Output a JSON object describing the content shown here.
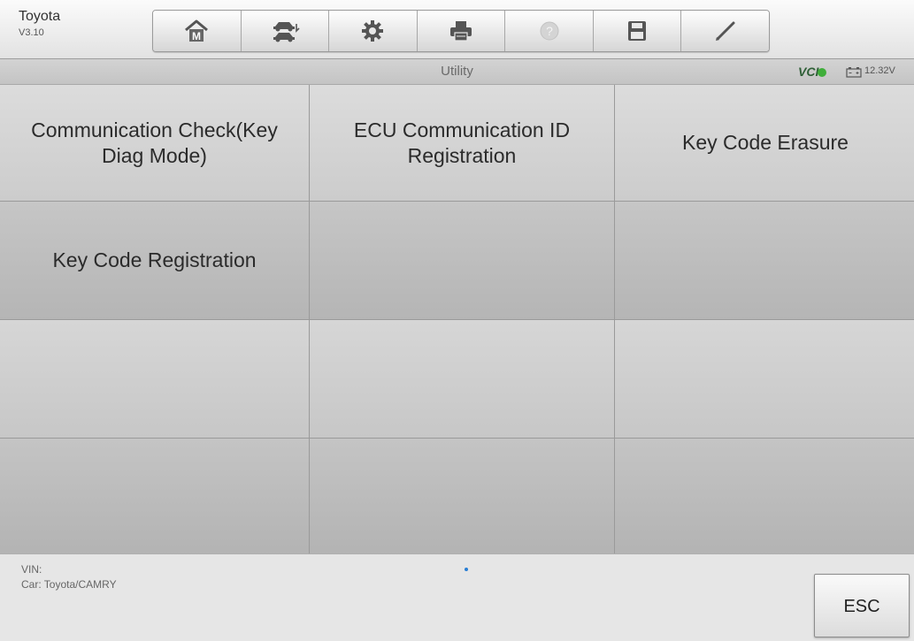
{
  "header": {
    "app_name": "Toyota",
    "version": "V3.10",
    "toolbar": [
      {
        "icon": "home-m-icon"
      },
      {
        "icon": "vehicle-swap-icon"
      },
      {
        "icon": "gear-icon"
      },
      {
        "icon": "printer-icon"
      },
      {
        "icon": "help-icon",
        "disabled": true
      },
      {
        "icon": "save-icon"
      },
      {
        "icon": "pen-icon"
      }
    ]
  },
  "titlebar": {
    "title": "Utility",
    "vci_label": "VCI",
    "voltage": "12.32V"
  },
  "grid": {
    "cells": [
      "Communication Check(Key Diag Mode)",
      "ECU Communication ID Registration",
      "Key Code Erasure",
      "Key Code Registration",
      "",
      "",
      "",
      "",
      "",
      "",
      "",
      ""
    ]
  },
  "footer": {
    "vin": "VIN:",
    "car": "Car: Toyota/CAMRY",
    "esc_label": "ESC"
  },
  "colors": {
    "vci_green": "#3fae3a",
    "page_indicator": "#2a7fd4"
  }
}
